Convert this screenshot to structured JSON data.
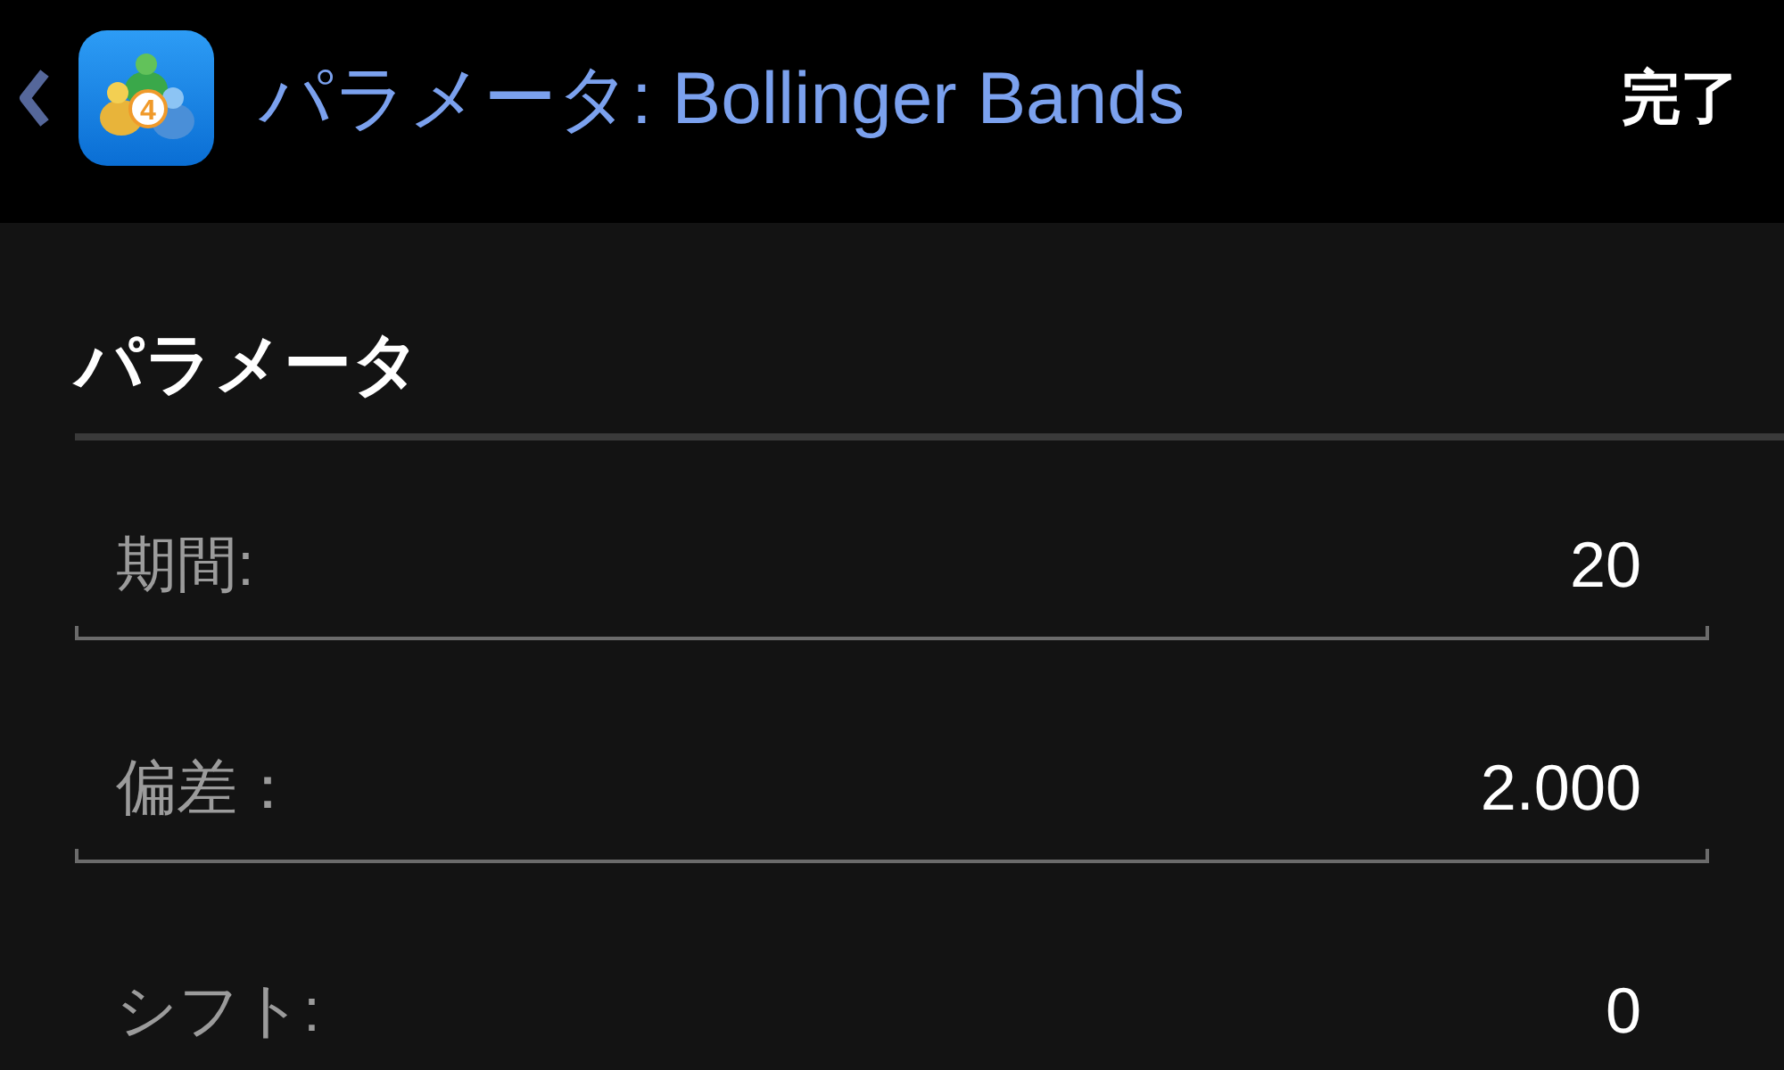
{
  "header": {
    "logo_badge": "4",
    "title": "パラメータ: Bollinger Bands",
    "done_button": "完了"
  },
  "section": {
    "title": "パラメータ"
  },
  "fields": [
    {
      "label": "期間:",
      "value": "20"
    },
    {
      "label": "偏差：",
      "value": "2.000"
    },
    {
      "label": "シフト:",
      "value": "0"
    }
  ]
}
